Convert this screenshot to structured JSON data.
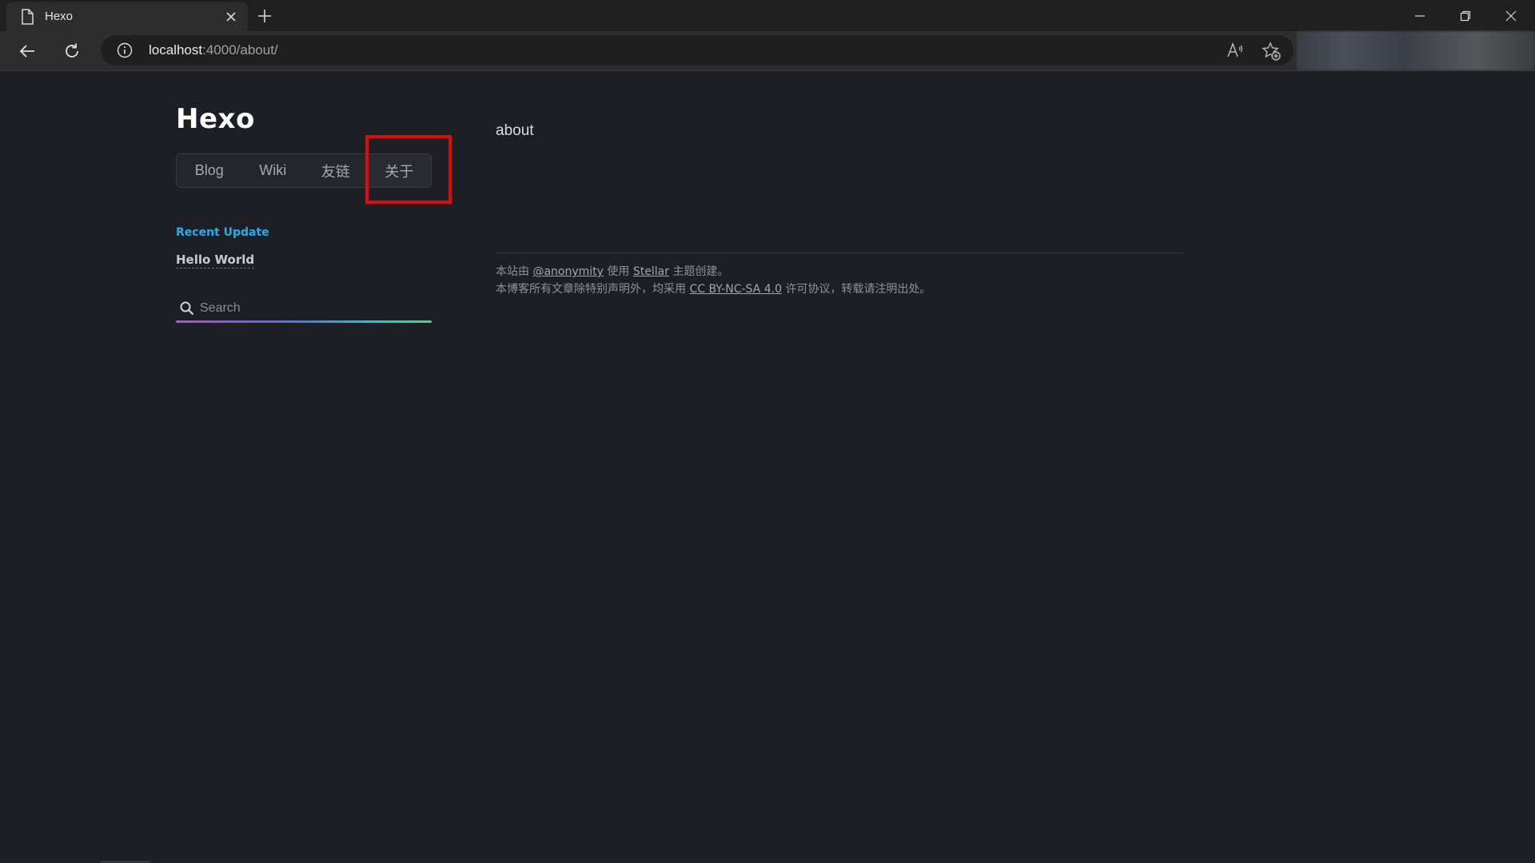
{
  "browser": {
    "tab_title": "Hexo",
    "url_host": "localhost",
    "url_path": ":4000/about/"
  },
  "site": {
    "title": "Hexo",
    "nav": [
      {
        "label": "Blog"
      },
      {
        "label": "Wiki"
      },
      {
        "label": "友链"
      },
      {
        "label": "关于"
      }
    ],
    "recent_update_label": "Recent Update",
    "recent_posts": [
      "Hello World"
    ],
    "search_placeholder": "Search"
  },
  "article": {
    "title": "about"
  },
  "footer": {
    "line1_prefix": "本站由 ",
    "line1_author": "@anonymity",
    "line1_mid": " 使用 ",
    "line1_theme": "Stellar",
    "line1_suffix": " 主题创建。",
    "line2_prefix": "本博客所有文章除特别声明外，均采用 ",
    "line2_license": "CC BY-NC-SA 4.0",
    "line2_suffix": " 许可协议，转载请注明出处。"
  },
  "colors": {
    "page_bg": "#1e1f24",
    "accent": "#1cb0f0",
    "highlight": "#e00c0c"
  }
}
